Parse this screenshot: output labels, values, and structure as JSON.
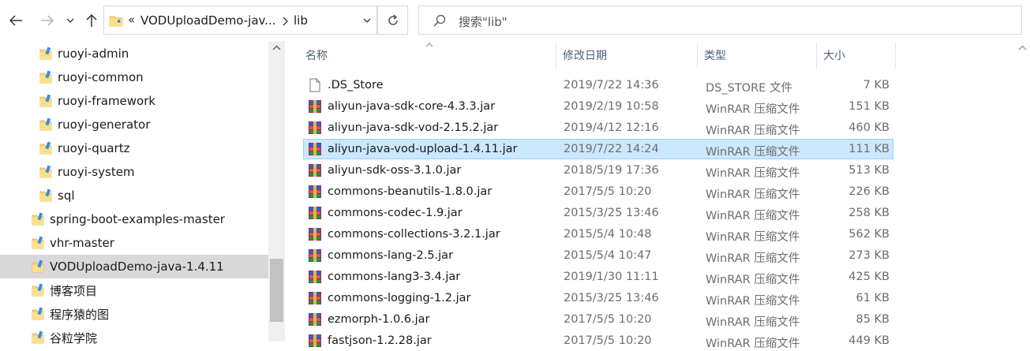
{
  "toolbar": {
    "back_icon": "arrow-left-icon",
    "forward_icon": "arrow-right-icon",
    "recent_icon": "chevron-down-icon",
    "up_icon": "arrow-up-icon",
    "path_overflow": "«",
    "path": [
      "VODUploadDemo-jav...",
      "lib"
    ],
    "search_placeholder": "搜索\"lib\""
  },
  "sidebar": {
    "items": [
      {
        "label": "ruoyi-admin",
        "indent": 2
      },
      {
        "label": "ruoyi-common",
        "indent": 2
      },
      {
        "label": "ruoyi-framework",
        "indent": 2
      },
      {
        "label": "ruoyi-generator",
        "indent": 2
      },
      {
        "label": "ruoyi-quartz",
        "indent": 2
      },
      {
        "label": "ruoyi-system",
        "indent": 2
      },
      {
        "label": "sql",
        "indent": 2
      },
      {
        "label": "spring-boot-examples-master",
        "indent": 1
      },
      {
        "label": "vhr-master",
        "indent": 1
      },
      {
        "label": "VODUploadDemo-java-1.4.11",
        "indent": 1,
        "selected": true
      },
      {
        "label": "博客项目",
        "indent": 1
      },
      {
        "label": "程序猿的图",
        "indent": 1
      },
      {
        "label": "谷粒学院",
        "indent": 1
      }
    ]
  },
  "columns": {
    "name": "名称",
    "date": "修改日期",
    "type": "类型",
    "size": "大小"
  },
  "files": [
    {
      "name": ".DS_Store",
      "date": "2019/7/22 14:36",
      "type": "DS_STORE 文件",
      "size": "7 KB",
      "icon": "file-icon"
    },
    {
      "name": "aliyun-java-sdk-core-4.3.3.jar",
      "date": "2019/2/19 10:58",
      "type": "WinRAR 压缩文件",
      "size": "151 KB",
      "icon": "winrar-icon"
    },
    {
      "name": "aliyun-java-sdk-vod-2.15.2.jar",
      "date": "2019/4/12 12:16",
      "type": "WinRAR 压缩文件",
      "size": "460 KB",
      "icon": "winrar-icon"
    },
    {
      "name": "aliyun-java-vod-upload-1.4.11.jar",
      "date": "2019/7/22 14:24",
      "type": "WinRAR 压缩文件",
      "size": "111 KB",
      "icon": "winrar-icon",
      "selected": true
    },
    {
      "name": "aliyun-sdk-oss-3.1.0.jar",
      "date": "2018/5/19 17:36",
      "type": "WinRAR 压缩文件",
      "size": "513 KB",
      "icon": "winrar-icon"
    },
    {
      "name": "commons-beanutils-1.8.0.jar",
      "date": "2017/5/5 10:20",
      "type": "WinRAR 压缩文件",
      "size": "226 KB",
      "icon": "winrar-icon"
    },
    {
      "name": "commons-codec-1.9.jar",
      "date": "2015/3/25 13:46",
      "type": "WinRAR 压缩文件",
      "size": "258 KB",
      "icon": "winrar-icon"
    },
    {
      "name": "commons-collections-3.2.1.jar",
      "date": "2015/5/4 10:48",
      "type": "WinRAR 压缩文件",
      "size": "562 KB",
      "icon": "winrar-icon"
    },
    {
      "name": "commons-lang-2.5.jar",
      "date": "2015/5/4 10:47",
      "type": "WinRAR 压缩文件",
      "size": "273 KB",
      "icon": "winrar-icon"
    },
    {
      "name": "commons-lang3-3.4.jar",
      "date": "2019/1/30 11:11",
      "type": "WinRAR 压缩文件",
      "size": "425 KB",
      "icon": "winrar-icon"
    },
    {
      "name": "commons-logging-1.2.jar",
      "date": "2015/3/25 13:46",
      "type": "WinRAR 压缩文件",
      "size": "61 KB",
      "icon": "winrar-icon"
    },
    {
      "name": "ezmorph-1.0.6.jar",
      "date": "2017/5/5 10:20",
      "type": "WinRAR 压缩文件",
      "size": "85 KB",
      "icon": "winrar-icon"
    },
    {
      "name": "fastjson-1.2.28.jar",
      "date": "2017/5/5 10:20",
      "type": "WinRAR 压缩文件",
      "size": "449 KB",
      "icon": "winrar-icon"
    }
  ],
  "colors": {
    "selection_bg": "#cce8ff",
    "selection_border": "#99d1ff",
    "sidebar_selected": "#d9d9d9",
    "header_text": "#4c607a",
    "folder_yellow": "#f8d775"
  }
}
